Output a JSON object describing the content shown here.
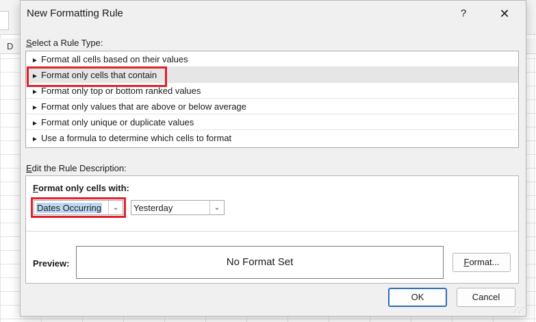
{
  "sheet": {
    "column_label": "D"
  },
  "dialog": {
    "title": "New Formatting Rule",
    "help_label": "?",
    "close_label": "✕",
    "rule_type_label_underlined": "S",
    "rule_type_label_rest": "elect a Rule Type:",
    "rule_types": [
      "Format all cells based on their values",
      "Format only cells that contain",
      "Format only top or bottom ranked values",
      "Format only values that are above or below average",
      "Format only unique or duplicate values",
      "Use a formula to determine which cells to format"
    ],
    "selected_rule_index": 1,
    "desc_label_underlined": "E",
    "desc_label_rest": "dit the Rule Description:",
    "format_only_underlined": "F",
    "format_only_rest": "ormat only cells with:",
    "condition_type_value": "Dates Occurring",
    "condition_value": "Yesterday",
    "preview_label": "Preview:",
    "preview_text": "No Format Set",
    "format_button_underlined": "F",
    "format_button_rest": "ormat...",
    "ok_label": "OK",
    "cancel_label": "Cancel"
  },
  "colors": {
    "highlight_red": "#e0202a",
    "selection_blue": "#bcd8f0",
    "ok_border": "#2d6ab5"
  }
}
